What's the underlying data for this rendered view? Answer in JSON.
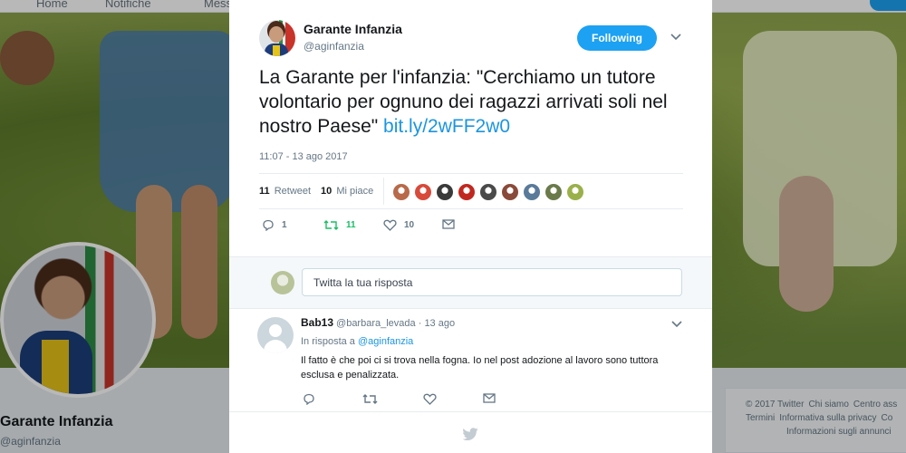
{
  "nav": {
    "home_label": "Home",
    "notifications_label": "Notifiche",
    "messages_label": "Messaggi"
  },
  "profile": {
    "name": "Garante Infanzia",
    "handle": "@aginfanzia"
  },
  "footer": {
    "links": [
      "© 2017 Twitter",
      "Chi siamo",
      "Centro ass",
      "Termini",
      "Informativa sulla privacy",
      "Co",
      "Informazioni sugli annunci"
    ]
  },
  "tweet": {
    "author_name": "Garante Infanzia",
    "author_handle": "@aginfanzia",
    "follow_label": "Following",
    "text": "La Garante per l'infanzia: \"Cerchiamo un tutore volontario per ognuno dei ragazzi arrivati soli nel nostro Paese\"",
    "link": "bit.ly/2wFF2w0",
    "timestamp": "11:07 - 13 ago 2017",
    "retweets_count": "11",
    "retweets_label": "Retweet",
    "likes_count": "10",
    "likes_label": "Mi piace",
    "action_reply_count": "1",
    "action_retweet_count": "11",
    "action_like_count": "10",
    "liker_colors": [
      "#b86a4a",
      "#d84a3a",
      "#3a3a3a",
      "#c0281f",
      "#4a4a4a",
      "#8a4a3a",
      "#5a7a9a",
      "#6a7a4a",
      "#9ab04a"
    ],
    "accent_color": "#1da1f2"
  },
  "reply_box": {
    "placeholder": "Twitta la tua risposta"
  },
  "reply": {
    "author_name": "Bab13",
    "author_handle": "@barbara_levada",
    "time": "· 13 ago",
    "in_reply_prefix": "In risposta a",
    "in_reply_mention": "@aginfanzia",
    "text": "Il fatto è che poi ci si trova nella fogna. Io nel post adozione  al lavoro sono tuttora esclusa e penalizzata."
  }
}
